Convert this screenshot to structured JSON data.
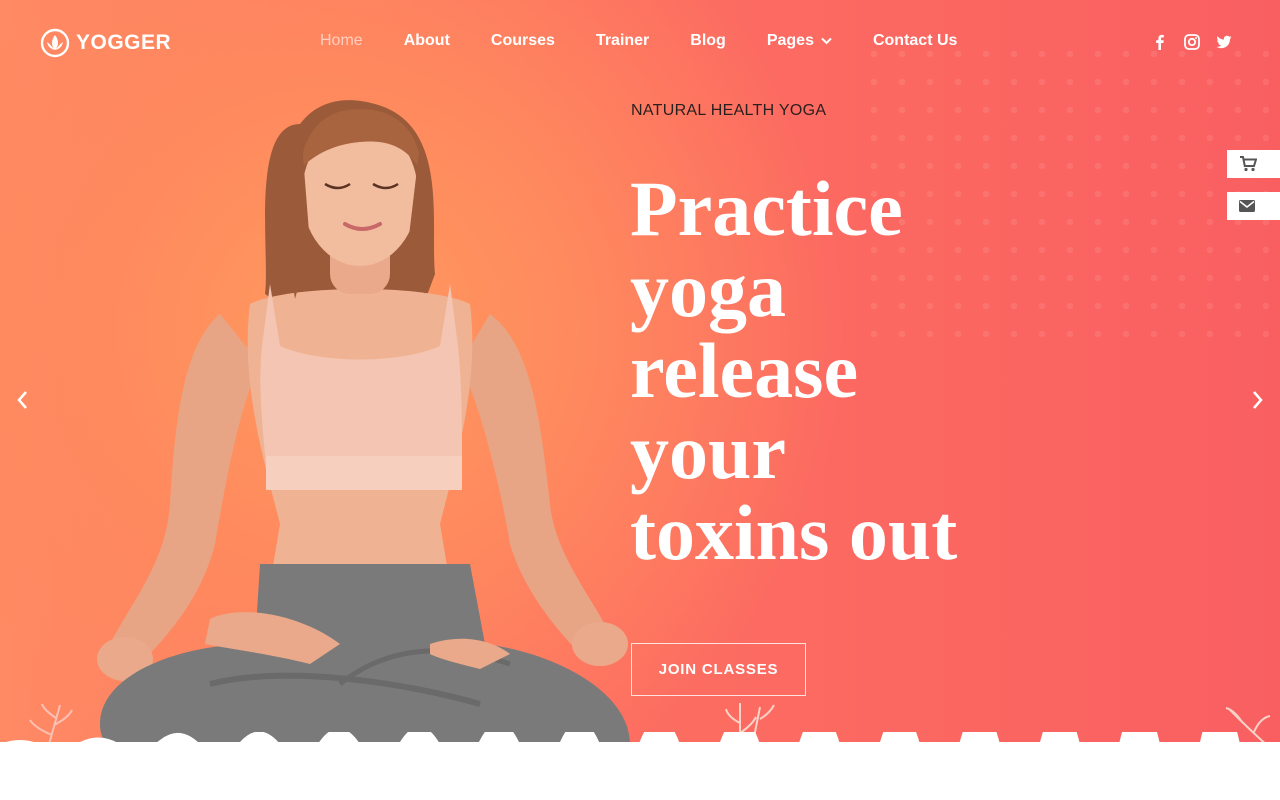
{
  "brand": {
    "name": "YOGGER",
    "icon": "lotus-icon"
  },
  "nav": {
    "items": [
      {
        "label": "Home",
        "active": true
      },
      {
        "label": "About"
      },
      {
        "label": "Courses"
      },
      {
        "label": "Trainer"
      },
      {
        "label": "Blog"
      },
      {
        "label": "Pages",
        "has_dropdown": true
      },
      {
        "label": "Contact Us"
      }
    ]
  },
  "social": [
    "facebook-icon",
    "instagram-icon",
    "twitter-icon"
  ],
  "hero": {
    "eyebrow": "NATURAL HEALTH YOGA",
    "headline_lines": [
      "Practice",
      "yoga",
      "release",
      "your",
      "toxins out"
    ],
    "cta_label": "JOIN CLASSES"
  },
  "side_tabs": [
    "cart-icon",
    "envelope-icon"
  ],
  "slider": {
    "prev_icon": "chevron-left-icon",
    "next_icon": "chevron-right-icon"
  },
  "colors": {
    "accent": "#fd6f61",
    "accent_light": "#ff9a5f",
    "text_dark": "#2a1f1f",
    "white": "#ffffff"
  }
}
